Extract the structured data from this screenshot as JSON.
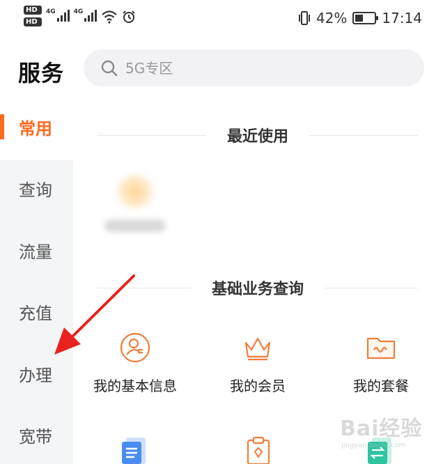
{
  "status_bar": {
    "hd1": "HD",
    "hd2": "HD",
    "net1": "4G",
    "net2": "4G",
    "battery_pct": "42%",
    "battery_level": 0.42,
    "time": "17:14"
  },
  "header": {
    "title": "服务",
    "search_placeholder": "5G专区"
  },
  "sidebar": {
    "items": [
      {
        "label": "常用",
        "active": true
      },
      {
        "label": "查询"
      },
      {
        "label": "流量"
      },
      {
        "label": "充值"
      },
      {
        "label": "办理"
      },
      {
        "label": "宽带"
      }
    ]
  },
  "sections": {
    "recent": "最近使用",
    "basic": "基础业务查询"
  },
  "grid": {
    "items": [
      {
        "label": "我的基本信息",
        "icon": "profile-icon"
      },
      {
        "label": "我的会员",
        "icon": "crown-icon"
      },
      {
        "label": "我的套餐",
        "icon": "folder-icon"
      }
    ],
    "row2_icons": [
      "document-icon",
      "clipboard-icon",
      "transfer-icon"
    ]
  },
  "colors": {
    "accent": "#ff6a1e",
    "icon_orange": "#ee7d3b",
    "icon_blue": "#4a8df0",
    "icon_teal": "#2ec4a0",
    "annotation_arrow": "#e8231f"
  },
  "watermark": {
    "text": "Bai经验",
    "sub": "jingyan.baidu.com"
  }
}
